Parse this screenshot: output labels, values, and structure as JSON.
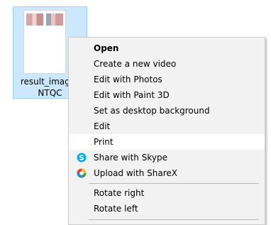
{
  "desktop": {
    "file": {
      "name_line1": "result_image_",
      "name_line2": "NTQC"
    }
  },
  "context_menu": {
    "items": [
      {
        "label": "Open"
      },
      {
        "label": "Create a new video"
      },
      {
        "label": "Edit with Photos"
      },
      {
        "label": "Edit with Paint 3D"
      },
      {
        "label": "Set as desktop background"
      },
      {
        "label": "Edit"
      },
      {
        "label": "Print"
      },
      {
        "label": "Share with Skype",
        "icon": "skype-icon"
      },
      {
        "label": "Upload with ShareX",
        "icon": "sharex-icon"
      },
      {
        "label": "Rotate right"
      },
      {
        "label": "Rotate left"
      }
    ],
    "highlighted": "Print"
  },
  "colors": {
    "selection_bg": "#cce8ff",
    "selection_border": "#99d1ff",
    "menu_bg": "#f2f2f2",
    "menu_hover": "#ffffff",
    "skype_blue": "#00aff0"
  }
}
